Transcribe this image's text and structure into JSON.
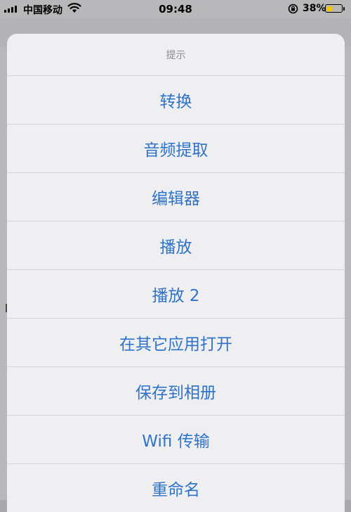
{
  "status_bar": {
    "carrier": "中国移动",
    "time": "09:48",
    "battery_percent": "38%",
    "battery_level": 0.38,
    "battery_color": "#f2c500"
  },
  "action_sheet": {
    "title": "提示",
    "items": [
      {
        "label": "转换"
      },
      {
        "label": "音频提取"
      },
      {
        "label": "编辑器"
      },
      {
        "label": "播放"
      },
      {
        "label": "播放 2"
      },
      {
        "label": "在其它应用打开"
      },
      {
        "label": "保存到相册"
      },
      {
        "label": "Wifi 传输"
      },
      {
        "label": "重命名"
      }
    ],
    "accent_color": "#2f73c9"
  },
  "icons": [
    "signal-icon",
    "wifi-icon",
    "rotation-lock-icon",
    "battery-icon",
    "menu-icon",
    "pen-icon"
  ]
}
